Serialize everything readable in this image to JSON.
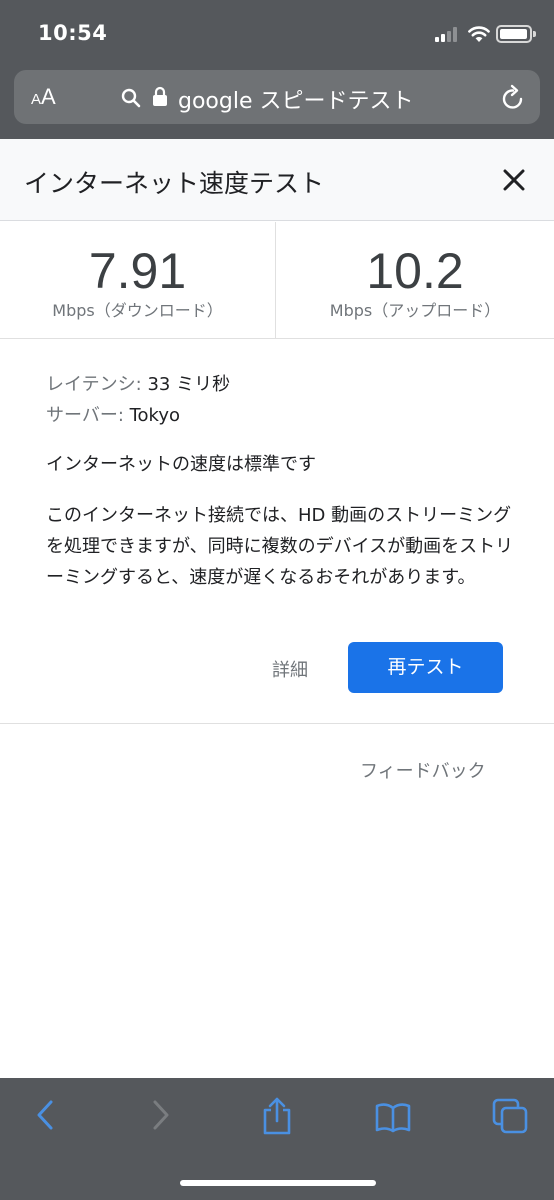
{
  "status_bar": {
    "time": "10:54"
  },
  "browser": {
    "text_size_small": "A",
    "text_size_big": "A",
    "address": "google スピードテスト"
  },
  "card": {
    "title": "インターネット速度テスト",
    "download": {
      "value": "7.91",
      "unit": "Mbps（ダウンロード）"
    },
    "upload": {
      "value": "10.2",
      "unit": "Mbps（アップロード）"
    },
    "latency_label": "レイテンシ: ",
    "latency_value": "33 ミリ秒",
    "server_label": "サーバー: ",
    "server_value": "Tokyo",
    "summary": "インターネットの速度は標準です",
    "description": "このインターネット接続では、HD 動画のストリーミングを処理できますが、同時に複数のデバイスが動画をストリーミングすると、速度が遅くなるおそれがあります。",
    "details_link": "詳細",
    "retest_button": "再テスト",
    "feedback": "フィードバック"
  },
  "colors": {
    "chrome": "#55585c",
    "accent": "#1a73e8",
    "toolbar_icon_active": "#4a90e2",
    "toolbar_icon_disabled": "#7a7d80"
  },
  "icons": {
    "url": [
      "search-icon",
      "lock-icon",
      "reload-icon"
    ],
    "toolbar": [
      "back-icon",
      "forward-icon",
      "share-icon",
      "bookmarks-icon",
      "tabs-icon"
    ]
  }
}
